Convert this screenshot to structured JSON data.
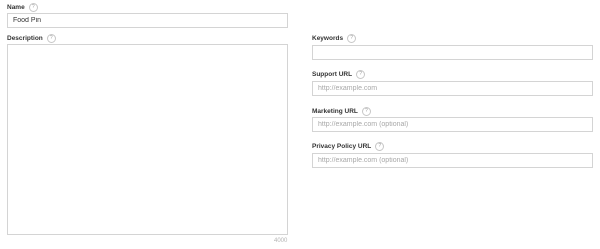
{
  "name": {
    "label": "Name",
    "help": "?",
    "value": "Food Pin"
  },
  "description": {
    "label": "Description",
    "help": "?",
    "value": "",
    "counter": "4000"
  },
  "keywords": {
    "label": "Keywords",
    "help": "?",
    "value": "",
    "placeholder": ""
  },
  "support_url": {
    "label": "Support URL",
    "help": "?",
    "placeholder": "http://example.com"
  },
  "marketing_url": {
    "label": "Marketing URL",
    "help": "?",
    "placeholder": "http://example.com (optional)"
  },
  "privacy_policy_url": {
    "label": "Privacy Policy URL",
    "help": "?",
    "placeholder": "http://example.com (optional)"
  }
}
